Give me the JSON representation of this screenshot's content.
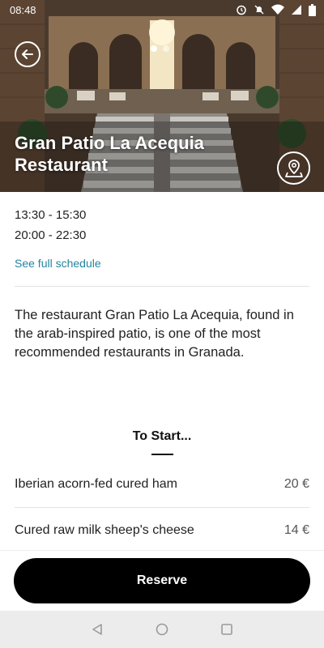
{
  "status": {
    "time": "08:48"
  },
  "hero": {
    "title": "Gran Patio La Acequia Restaurant",
    "icons": {
      "back": "arrow-left-icon",
      "map": "map-pin-icon"
    },
    "carousel": {
      "count": 2,
      "active": 1
    }
  },
  "schedule": {
    "slots": [
      "13:30 - 15:30",
      "20:00 - 22:30"
    ],
    "link_label": "See full schedule"
  },
  "description": "The restaurant Gran Patio La Acequia, found in the arab-inspired patio, is one of the most recommended restaurants in Granada.",
  "menu": {
    "section_title": "To Start...",
    "items": [
      {
        "name": "Iberian acorn-fed cured ham",
        "price": "20 €"
      },
      {
        "name": "Cured raw milk sheep's cheese",
        "price": "14 €"
      }
    ]
  },
  "actions": {
    "reserve_label": "Reserve"
  },
  "colors": {
    "accent": "#2484a0",
    "button": "#000000",
    "navbar": "#ececec"
  }
}
